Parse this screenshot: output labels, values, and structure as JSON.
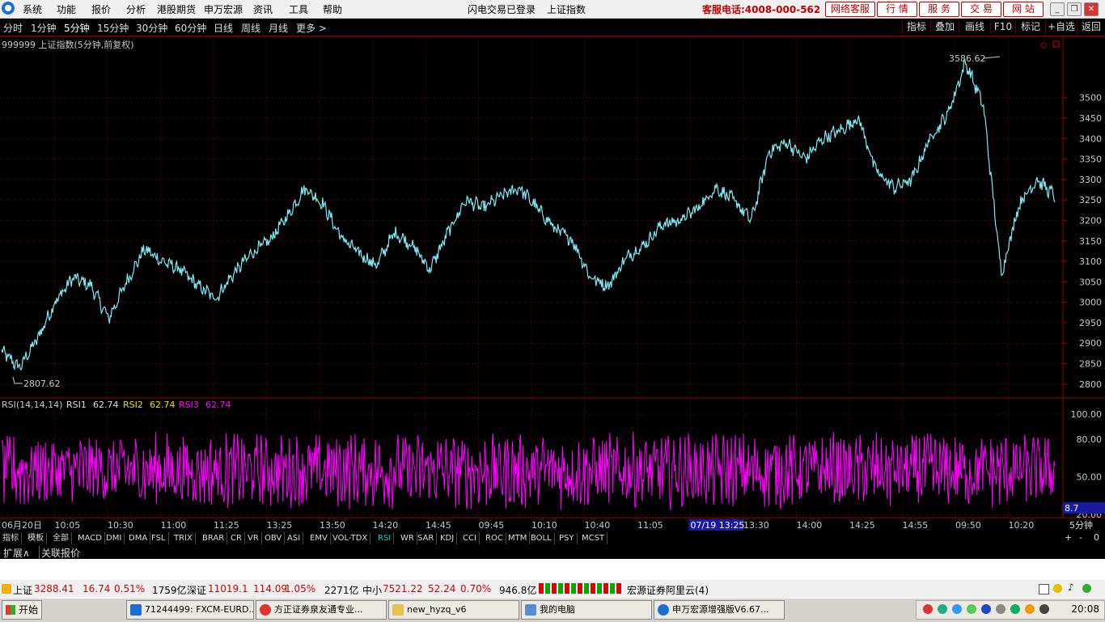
{
  "menu": {
    "items": [
      "系统",
      "功能",
      "报价",
      "分析",
      "港股期货",
      "申万宏源",
      "资讯",
      "工具",
      "帮助"
    ],
    "status": "闪电交易已登录",
    "index_name": "上证指数",
    "hotline": "客服电话:4008-000-562",
    "buttons": [
      "网络客服",
      "行 情",
      "服 务",
      "交 易",
      "网 站"
    ]
  },
  "periods": {
    "items": [
      "分时",
      "1分钟",
      "5分钟",
      "15分钟",
      "30分钟",
      "60分钟",
      "日线",
      "周线",
      "月线",
      "更多 >"
    ],
    "active": "5分钟"
  },
  "right_tabs": [
    "指标",
    "叠加",
    "画线",
    "F10",
    "标记",
    "+自选",
    "返回"
  ],
  "chart_title": "999999 上证指数(5分钟,前复权)",
  "colors": {
    "price_line": "#7fe8f0",
    "rsi_line": "#ff00ff",
    "grid": "#7a0000",
    "axis_text": "#c8c8c8",
    "accent_red": "#d00000"
  },
  "chart_data": [
    {
      "type": "line",
      "title": "999999 上证指数(5分钟,前复权)",
      "series": [
        {
          "name": "上证指数",
          "values": [
            2880,
            2840,
            2910,
            3000,
            3060,
            3040,
            2960,
            3050,
            3130,
            3100,
            3080,
            3040,
            3010,
            3070,
            3120,
            3150,
            3210,
            3280,
            3240,
            3160,
            3120,
            3090,
            3170,
            3140,
            3080,
            3170,
            3250,
            3230,
            3260,
            3280,
            3230,
            3180,
            3150,
            3060,
            3040,
            3110,
            3140,
            3190,
            3200,
            3230,
            3280,
            3250,
            3200,
            3370,
            3390,
            3350,
            3400,
            3420,
            3450,
            3320,
            3280,
            3300,
            3400,
            3460,
            3586,
            3480,
            3070,
            3240,
            3300,
            3260
          ]
        }
      ],
      "ylim": [
        2770,
        3620
      ],
      "yticks": [
        "3500",
        "3450",
        "3400",
        "3350",
        "3300",
        "3250",
        "3200",
        "3150",
        "3100",
        "3050",
        "3000",
        "2950",
        "2900",
        "2850",
        "2800"
      ],
      "xticks": [
        "06月20日",
        "10:05",
        "10:30",
        "11:00",
        "11:25",
        "13:25",
        "13:50",
        "14:20",
        "14:45",
        "09:45",
        "10:10",
        "10:40",
        "11:05",
        "07/19 13:25",
        "13:30",
        "14:00",
        "14:25",
        "14:55",
        "09:50",
        "10:20"
      ],
      "annotations": [
        "3586.62",
        "2807.62"
      ],
      "period_label": "5分钟"
    },
    {
      "type": "line",
      "title": "RSI(14,14,14)",
      "series": [
        {
          "name": "RSI1",
          "last": "62.74"
        },
        {
          "name": "RSI2",
          "last": "62.74"
        },
        {
          "name": "RSI3",
          "last": "62.74"
        }
      ],
      "ylim": [
        20,
        100
      ],
      "yticks": [
        "100.00",
        "80.00",
        "50.00",
        "20.00"
      ],
      "cursor_value": "8.7"
    }
  ],
  "bottom_tabs": [
    "指标",
    "模板",
    "全部",
    "MACD",
    "DMI",
    "DMA",
    "FSL",
    "TRIX",
    "BRAR",
    "CR",
    "VR",
    "OBV",
    "ASI",
    "EMV",
    "VOL-TDX",
    "RSI",
    "WR",
    "SAR",
    "KDJ",
    "CCI",
    "ROC",
    "MTM",
    "BOLL",
    "PSY",
    "MCST"
  ],
  "bottom_tab_selected": "RSI",
  "extension": [
    "扩展∧",
    "关联报价"
  ],
  "status": {
    "sh_label": "上证",
    "sh_val": "3288.41",
    "sh_chg": "16.74",
    "sh_pct": "0.51%",
    "sh_amt": "1759亿",
    "sz_label": "深证",
    "sz_val": "11019.1",
    "sz_chg": "114.09",
    "sz_pct": "1.05%",
    "sz_amt": "2271亿",
    "zx_label": "中小",
    "zx_val": "7521.22",
    "zx_chg": "52.24",
    "zx_pct": "0.70%",
    "zx_amt": "946.8亿",
    "server": "宏源证券阿里云(4)"
  },
  "taskbar": {
    "start": "开始",
    "tasks": [
      "71244499: FXCM-EURD...",
      "方正证券泉友通专业...",
      "new_hyzq_v6",
      "我的电脑",
      "申万宏源增强版V6.67..."
    ],
    "clock": "20:08"
  }
}
